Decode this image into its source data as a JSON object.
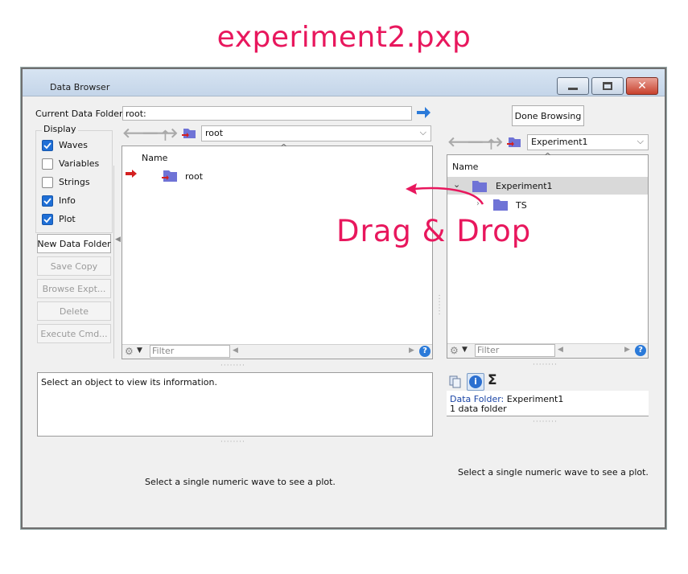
{
  "page": {
    "title": "experiment2.pxp"
  },
  "window": {
    "title": "Data Browser",
    "controls": {
      "minimize": "minimize",
      "maximize": "maximize",
      "close": "close"
    }
  },
  "left": {
    "current_folder_label": "Current Data Folder:",
    "current_folder_value": "root:",
    "display": {
      "label": "Display",
      "items": [
        {
          "label": "Waves",
          "checked": true
        },
        {
          "label": "Variables",
          "checked": false
        },
        {
          "label": "Strings",
          "checked": false
        },
        {
          "label": "Info",
          "checked": true
        },
        {
          "label": "Plot",
          "checked": true
        }
      ]
    },
    "buttons": {
      "new_folder": "New Data Folder",
      "save_copy": "Save Copy",
      "browse_expt": "Browse Expt...",
      "delete": "Delete",
      "execute_cmd": "Execute Cmd..."
    },
    "folder_combo": "root",
    "tree": {
      "column_header": "Name",
      "root_item": "root"
    },
    "filter_placeholder": "Filter",
    "info_message": "Select an object to view its information.",
    "plot_message": "Select a single numeric wave to see a plot."
  },
  "right": {
    "done_button": "Done Browsing",
    "experiment_combo": "Experiment1",
    "tree": {
      "column_header": "Name",
      "experiment_item": "Experiment1",
      "child_item": "TS"
    },
    "filter_placeholder": "Filter",
    "info": {
      "folder_label": "Data Folder:",
      "folder_value": "Experiment1",
      "count": "1 data folder"
    },
    "sigma_symbol": "Σ",
    "plot_message": "Select a single numeric wave to see a plot."
  },
  "annotation": {
    "text": "Drag & Drop",
    "color": "#e8175d"
  },
  "colors": {
    "accent": "#1f6fd6",
    "annotation": "#e8175d",
    "folder": "#6f73d6",
    "selection": "#d9d9d9"
  },
  "icons": {
    "go_arrow": "arrow-right-icon",
    "back": "back-arrow-icon",
    "forward": "forward-arrow-icon",
    "up": "up-arrow-icon",
    "folder": "data-folder-icon",
    "current_marker": "current-folder-marker-icon",
    "help": "help-icon",
    "settings": "settings-gear-icon"
  }
}
